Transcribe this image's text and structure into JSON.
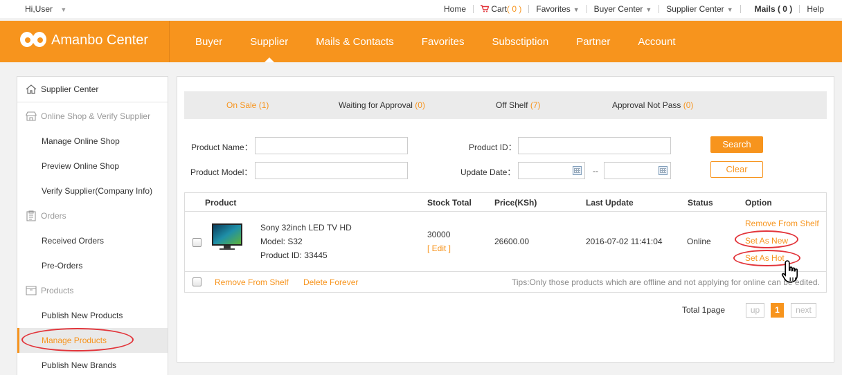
{
  "topbar": {
    "greeting": "Hi,User",
    "home": "Home",
    "cart_label": "Cart",
    "cart_count": "( 0 )",
    "favorites": "Favorites",
    "buyer_center": "Buyer Center",
    "supplier_center": "Supplier Center",
    "mails_label": "Mails",
    "mails_count": "( 0 )",
    "help": "Help"
  },
  "header": {
    "brand": "Amanbo Center",
    "nav": [
      "Buyer",
      "Supplier",
      "Mails & Contacts",
      "Favorites",
      "Subsctiption",
      "Partner",
      "Account"
    ],
    "active_nav": "Supplier"
  },
  "sidebar": {
    "home": "Supplier Center",
    "sections": [
      {
        "title": "Online Shop & Verify Supplier",
        "icon": "shop-icon",
        "items": [
          "Manage Online Shop",
          "Preview Online Shop",
          "Verify Supplier(Company Info)"
        ]
      },
      {
        "title": "Orders",
        "icon": "clipboard-icon",
        "items": [
          "Received Orders",
          "Pre-Orders"
        ]
      },
      {
        "title": "Products",
        "icon": "box-icon",
        "items": [
          "Publish New Products",
          "Manage Products",
          "Publish New Brands"
        ]
      }
    ],
    "selected": "Manage Products"
  },
  "tabs": [
    {
      "label": "On Sale",
      "count": "(1)"
    },
    {
      "label": "Waiting for Approval",
      "count": "(0)"
    },
    {
      "label": "Off Shelf",
      "count": "(7)"
    },
    {
      "label": "Approval Not Pass",
      "count": "(0)"
    }
  ],
  "filters": {
    "product_name_label": "Product Name：",
    "product_model_label": "Product Model：",
    "product_id_label": "Product ID：",
    "update_date_label": "Update Date：",
    "date_separator": "--",
    "search_button": "Search",
    "clear_button": "Clear"
  },
  "table": {
    "headers": [
      "Product",
      "Stock Total",
      "Price(KSh)",
      "Last Update",
      "Status",
      "Option"
    ],
    "rows": [
      {
        "name": "Sony 32inch LED TV HD",
        "model": "Model: S32",
        "product_id": "Product ID: 33445",
        "stock": "30000",
        "edit": "[ Edit ]",
        "price": "26600.00",
        "last_update": "2016-07-02 11:41:04",
        "status": "Online",
        "options": [
          "Remove From Shelf",
          "Set As New",
          "Set As Hot"
        ]
      }
    ],
    "footer": {
      "remove": "Remove From Shelf",
      "delete": "Delete Forever",
      "tips": "Tips:Only those products which are offline and not applying for online can be edited."
    }
  },
  "pager": {
    "total": "Total 1page",
    "prev": "up",
    "current": "1",
    "next": "next"
  },
  "colors": {
    "accent": "#f7941d",
    "annotation": "#e2343a"
  }
}
